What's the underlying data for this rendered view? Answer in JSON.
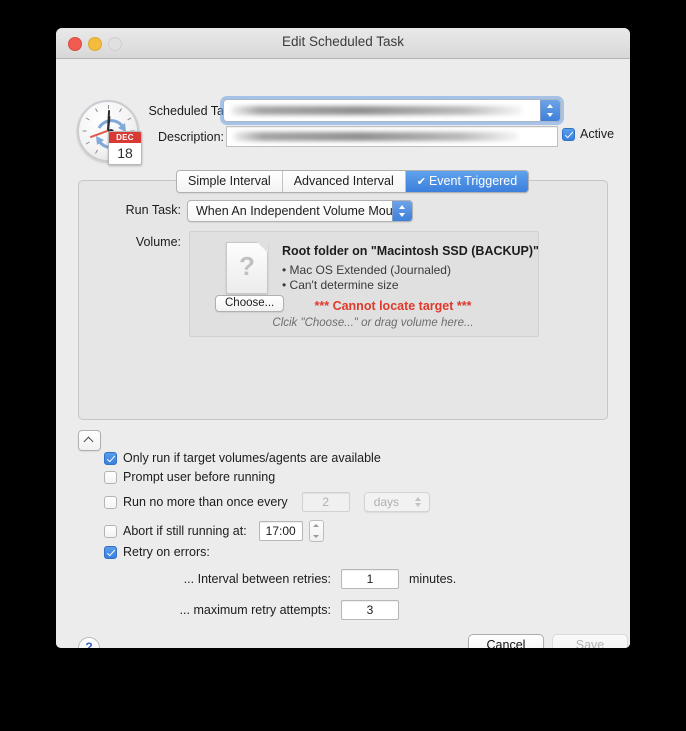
{
  "window": {
    "title": "Edit Scheduled Task",
    "traffic_lights": [
      "close",
      "minimize",
      "zoom"
    ]
  },
  "icon": {
    "name": "clock-calendar-icon",
    "calendar_month": "DEC",
    "calendar_day": "18"
  },
  "form": {
    "scheduled_task_label": "Scheduled Ta",
    "scheduled_task_value": "",
    "description_label": "Description:",
    "description_value": "",
    "active_label": "Active",
    "active_checked": true
  },
  "tabs": [
    {
      "label": "Simple Interval",
      "active": false
    },
    {
      "label": "Advanced Interval",
      "active": false
    },
    {
      "label": "Event Triggered",
      "active": true,
      "check": "✔"
    }
  ],
  "panel": {
    "run_task_label": "Run Task:",
    "run_task_value": "When An Independent Volume Mounts",
    "volume_label": "Volume:",
    "volume": {
      "icon": "unknown-document-icon",
      "glyph": "?",
      "choose_button": "Choose...",
      "title": "Root folder on \"Macintosh SSD (BACKUP)\"",
      "bullets": [
        "• Mac OS Extended (Journaled)",
        "• Can't determine size"
      ],
      "error": "*** Cannot locate target ***",
      "hint": "Clcik \"Choose...\" or drag volume here..."
    }
  },
  "options": {
    "only_run_label": "Only run if target volumes/agents are available",
    "only_run_checked": true,
    "prompt_label": "Prompt user before running",
    "prompt_checked": false,
    "no_more_label": "Run no more than once every",
    "no_more_checked": false,
    "no_more_value": "2",
    "no_more_unit": "days",
    "abort_label": "Abort if still running at:",
    "abort_checked": false,
    "abort_time": "17:00",
    "retry_label": "Retry on errors:",
    "retry_checked": true,
    "interval_label": "... Interval between retries:",
    "interval_value": "1",
    "interval_unit": "minutes.",
    "max_attempts_label": "... maximum retry attempts:",
    "max_attempts_value": "3"
  },
  "footer": {
    "help": "?",
    "cancel": "Cancel",
    "save": "Save"
  },
  "colors": {
    "accent": "#3c7fdc",
    "error": "#e0392b",
    "calendar_red": "#d93b34",
    "window_bg": "#ececec"
  }
}
